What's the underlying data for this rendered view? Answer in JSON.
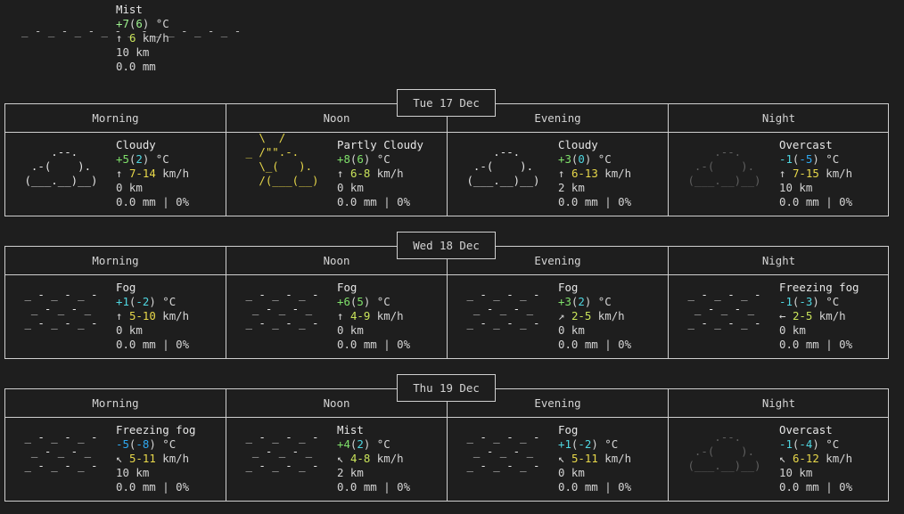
{
  "current": {
    "condition": "Mist",
    "temp": "+7",
    "feels": "6",
    "unit": "°C",
    "wind_dir": "↑",
    "wind": "6",
    "wind_unit": "km/h",
    "visibility": "10 km",
    "precip": "0.0 mm"
  },
  "period_labels": [
    "Morning",
    "Noon",
    "Evening",
    "Night"
  ],
  "days": [
    {
      "date": "Tue 17 Dec",
      "periods": [
        {
          "icon": "cloudy-icon",
          "condition": "Cloudy",
          "temp": "+5",
          "feels": "2",
          "wind_dir": "↑",
          "wind": "7-14",
          "visibility": "0 km",
          "precip": "0.0 mm | 0%"
        },
        {
          "icon": "partly-cloudy-icon",
          "condition": "Partly Cloudy",
          "temp": "+8",
          "feels": "6",
          "wind_dir": "↑",
          "wind": "6-8",
          "visibility": "0 km",
          "precip": "0.0 mm | 0%"
        },
        {
          "icon": "cloudy-icon",
          "condition": "Cloudy",
          "temp": "+3",
          "feels": "0",
          "wind_dir": "↑",
          "wind": "6-13",
          "visibility": "2 km",
          "precip": "0.0 mm | 0%"
        },
        {
          "icon": "overcast-icon",
          "condition": "Overcast",
          "temp": "-1",
          "feels": "-5",
          "wind_dir": "↑",
          "wind": "7-15",
          "visibility": "10 km",
          "precip": "0.0 mm | 0%"
        }
      ]
    },
    {
      "date": "Wed 18 Dec",
      "periods": [
        {
          "icon": "fog-icon",
          "condition": "Fog",
          "temp": "+1",
          "feels": "-2",
          "wind_dir": "↑",
          "wind": "5-10",
          "visibility": "0 km",
          "precip": "0.0 mm | 0%"
        },
        {
          "icon": "fog-icon",
          "condition": "Fog",
          "temp": "+6",
          "feels": "5",
          "wind_dir": "↑",
          "wind": "4-9",
          "visibility": "0 km",
          "precip": "0.0 mm | 0%"
        },
        {
          "icon": "fog-icon",
          "condition": "Fog",
          "temp": "+3",
          "feels": "2",
          "wind_dir": "↗",
          "wind": "2-5",
          "visibility": "0 km",
          "precip": "0.0 mm | 0%"
        },
        {
          "icon": "fog-icon",
          "condition": "Freezing fog",
          "temp": "-1",
          "feels": "-3",
          "wind_dir": "←",
          "wind": "2-5",
          "visibility": "0 km",
          "precip": "0.0 mm | 0%"
        }
      ]
    },
    {
      "date": "Thu 19 Dec",
      "periods": [
        {
          "icon": "fog-icon",
          "condition": "Freezing fog",
          "temp": "-5",
          "feels": "-8",
          "wind_dir": "↖",
          "wind": "5-11",
          "visibility": "10 km",
          "precip": "0.0 mm | 0%"
        },
        {
          "icon": "fog-icon",
          "condition": "Mist",
          "temp": "+4",
          "feels": "2",
          "wind_dir": "↖",
          "wind": "4-8",
          "visibility": "2 km",
          "precip": "0.0 mm | 0%"
        },
        {
          "icon": "fog-icon",
          "condition": "Fog",
          "temp": "+1",
          "feels": "-2",
          "wind_dir": "↖",
          "wind": "5-11",
          "visibility": "0 km",
          "precip": "0.0 mm | 0%"
        },
        {
          "icon": "overcast-icon",
          "condition": "Overcast",
          "temp": "-1",
          "feels": "-4",
          "wind_dir": "↖",
          "wind": "6-12",
          "visibility": "10 km",
          "precip": "0.0 mm | 0%"
        }
      ]
    }
  ],
  "unit": "°C",
  "wind_unit": "km/h"
}
